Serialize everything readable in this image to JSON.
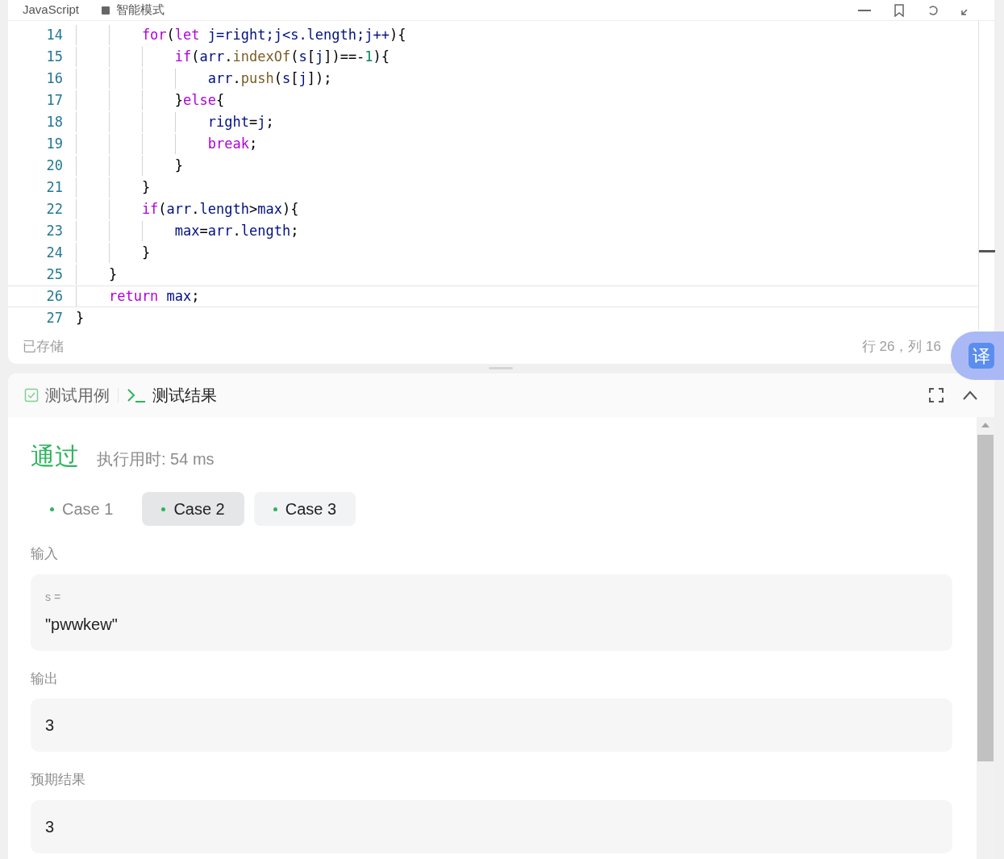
{
  "editor": {
    "language": "JavaScript",
    "mode": "智能模式",
    "lines": [
      {
        "number": "14",
        "current": false,
        "tokens": [
          {
            "kind": "keyword",
            "t": "        for"
          },
          {
            "kind": "plain",
            "t": "("
          },
          {
            "kind": "keyword",
            "t": "let"
          },
          {
            "kind": "variable",
            "t": " j=right;j<s.length;j++"
          },
          {
            "kind": "plain",
            "t": "){"
          }
        ]
      },
      {
        "number": "15",
        "current": false,
        "tokens": [
          {
            "kind": "keyword",
            "t": "            if"
          },
          {
            "kind": "plain",
            "t": "("
          },
          {
            "kind": "variable",
            "t": "arr"
          },
          {
            "kind": "plain",
            "t": "."
          },
          {
            "kind": "function",
            "t": "indexOf"
          },
          {
            "kind": "plain",
            "t": "("
          },
          {
            "kind": "variable",
            "t": "s"
          },
          {
            "kind": "plain",
            "t": "["
          },
          {
            "kind": "variable",
            "t": "j"
          },
          {
            "kind": "plain",
            "t": "])==-"
          },
          {
            "kind": "number",
            "t": "1"
          },
          {
            "kind": "plain",
            "t": "){"
          }
        ]
      },
      {
        "number": "16",
        "current": false,
        "tokens": [
          {
            "kind": "variable",
            "t": "                arr"
          },
          {
            "kind": "plain",
            "t": "."
          },
          {
            "kind": "function",
            "t": "push"
          },
          {
            "kind": "plain",
            "t": "("
          },
          {
            "kind": "variable",
            "t": "s"
          },
          {
            "kind": "plain",
            "t": "["
          },
          {
            "kind": "variable",
            "t": "j"
          },
          {
            "kind": "plain",
            "t": "]);"
          }
        ]
      },
      {
        "number": "17",
        "current": false,
        "tokens": [
          {
            "kind": "plain",
            "t": "            }"
          },
          {
            "kind": "keyword",
            "t": "else"
          },
          {
            "kind": "plain",
            "t": "{"
          }
        ]
      },
      {
        "number": "18",
        "current": false,
        "tokens": [
          {
            "kind": "variable",
            "t": "                right"
          },
          {
            "kind": "plain",
            "t": "="
          },
          {
            "kind": "variable",
            "t": "j"
          },
          {
            "kind": "plain",
            "t": ";"
          }
        ]
      },
      {
        "number": "19",
        "current": false,
        "tokens": [
          {
            "kind": "keyword",
            "t": "                break"
          },
          {
            "kind": "plain",
            "t": ";"
          }
        ]
      },
      {
        "number": "20",
        "current": false,
        "tokens": [
          {
            "kind": "plain",
            "t": "            }"
          }
        ]
      },
      {
        "number": "21",
        "current": false,
        "tokens": [
          {
            "kind": "plain",
            "t": "        }"
          }
        ]
      },
      {
        "number": "22",
        "current": false,
        "tokens": [
          {
            "kind": "keyword",
            "t": "        if"
          },
          {
            "kind": "plain",
            "t": "("
          },
          {
            "kind": "variable",
            "t": "arr"
          },
          {
            "kind": "plain",
            "t": "."
          },
          {
            "kind": "variable",
            "t": "length"
          },
          {
            "kind": "plain",
            "t": ">"
          },
          {
            "kind": "variable",
            "t": "max"
          },
          {
            "kind": "plain",
            "t": "){"
          }
        ]
      },
      {
        "number": "23",
        "current": false,
        "tokens": [
          {
            "kind": "variable",
            "t": "            max"
          },
          {
            "kind": "plain",
            "t": "="
          },
          {
            "kind": "variable",
            "t": "arr"
          },
          {
            "kind": "plain",
            "t": "."
          },
          {
            "kind": "variable",
            "t": "length"
          },
          {
            "kind": "plain",
            "t": ";"
          }
        ]
      },
      {
        "number": "24",
        "current": false,
        "tokens": [
          {
            "kind": "plain",
            "t": "        }"
          }
        ]
      },
      {
        "number": "25",
        "current": false,
        "tokens": [
          {
            "kind": "plain",
            "t": "    }"
          }
        ]
      },
      {
        "number": "26",
        "current": true,
        "tokens": [
          {
            "kind": "keyword",
            "t": "    return"
          },
          {
            "kind": "variable",
            "t": " max"
          },
          {
            "kind": "plain",
            "t": ";"
          }
        ]
      },
      {
        "number": "27",
        "current": false,
        "tokens": [
          {
            "kind": "plain",
            "t": "}"
          }
        ]
      }
    ],
    "status_left": "已存储",
    "status_right": "行 26，列 16",
    "translate_label": "译"
  },
  "panel": {
    "tabs": [
      {
        "label": "测试用例",
        "kind": "check",
        "selected": false
      },
      {
        "label": "测试结果",
        "kind": "terminal",
        "selected": true
      }
    ],
    "result": "通过",
    "runtime": "执行用时: 54 ms",
    "cases": [
      {
        "label": "Case 1",
        "selected": false,
        "hovered": false
      },
      {
        "label": "Case 2",
        "selected": true,
        "hovered": false
      },
      {
        "label": "Case 3",
        "selected": false,
        "hovered": true
      }
    ],
    "sections": [
      {
        "title": "输入",
        "variable": "s =",
        "value": "\"pwwkew\""
      },
      {
        "title": "输出",
        "value": "3"
      },
      {
        "title": "预期结果",
        "value": "3"
      }
    ]
  }
}
